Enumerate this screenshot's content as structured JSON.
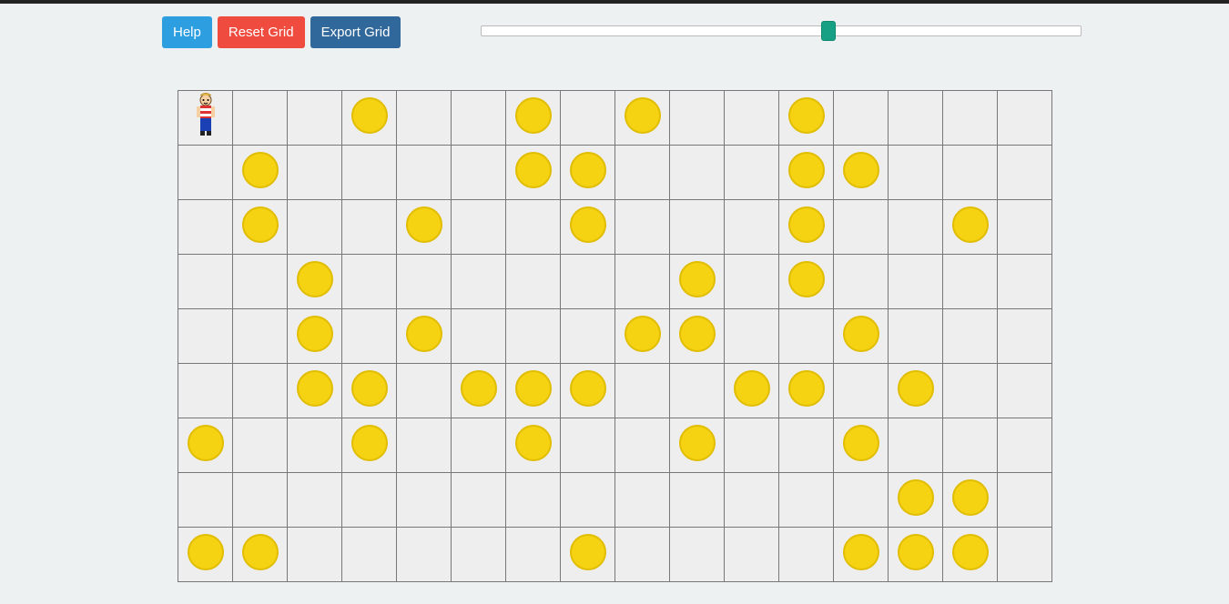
{
  "toolbar": {
    "help_label": "Help",
    "reset_label": "Reset Grid",
    "export_label": "Export Grid"
  },
  "slider": {
    "min": 0,
    "max": 100,
    "value": 58
  },
  "grid": {
    "rows": 9,
    "cols": 16,
    "player": {
      "row": 0,
      "col": 0
    },
    "coins": [
      [
        0,
        3
      ],
      [
        0,
        6
      ],
      [
        0,
        8
      ],
      [
        0,
        11
      ],
      [
        1,
        1
      ],
      [
        1,
        6
      ],
      [
        1,
        7
      ],
      [
        1,
        11
      ],
      [
        1,
        12
      ],
      [
        2,
        1
      ],
      [
        2,
        4
      ],
      [
        2,
        7
      ],
      [
        2,
        11
      ],
      [
        2,
        14
      ],
      [
        3,
        2
      ],
      [
        3,
        9
      ],
      [
        3,
        11
      ],
      [
        4,
        2
      ],
      [
        4,
        4
      ],
      [
        4,
        8
      ],
      [
        4,
        9
      ],
      [
        4,
        12
      ],
      [
        5,
        2
      ],
      [
        5,
        3
      ],
      [
        5,
        5
      ],
      [
        5,
        6
      ],
      [
        5,
        7
      ],
      [
        5,
        10
      ],
      [
        5,
        11
      ],
      [
        5,
        13
      ],
      [
        6,
        0
      ],
      [
        6,
        3
      ],
      [
        6,
        6
      ],
      [
        6,
        9
      ],
      [
        6,
        12
      ],
      [
        7,
        13
      ],
      [
        7,
        14
      ],
      [
        8,
        0
      ],
      [
        8,
        1
      ],
      [
        8,
        7
      ],
      [
        8,
        12
      ],
      [
        8,
        13
      ],
      [
        8,
        14
      ]
    ]
  }
}
